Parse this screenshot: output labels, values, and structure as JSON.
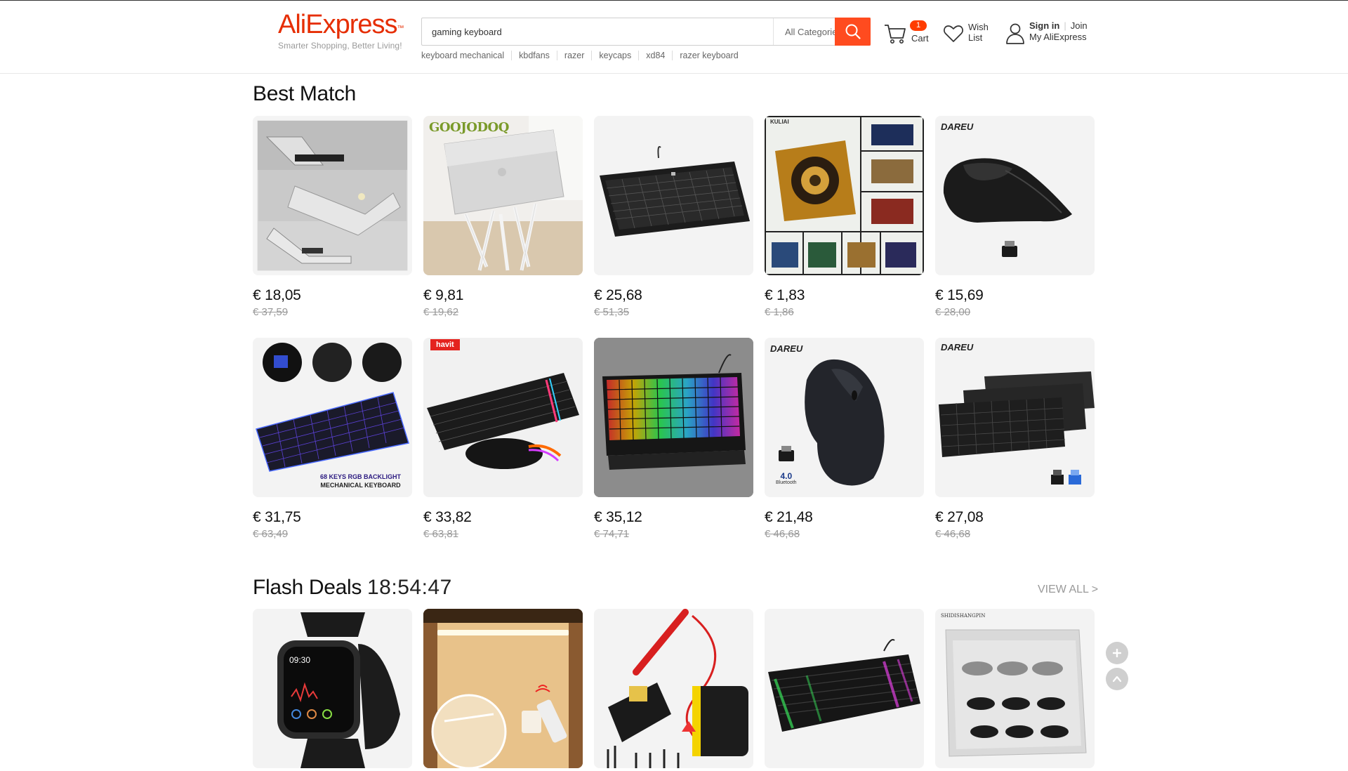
{
  "header": {
    "logo": {
      "brand": "AliExpress",
      "tagline": "Smarter Shopping, Better Living!"
    },
    "search": {
      "value": "gaming keyboard",
      "category": "All Categories",
      "button_icon": "search-icon"
    },
    "suggestions": [
      "keyboard mechanical",
      "kbdfans",
      "razer",
      "keycaps",
      "xd84",
      "razer keyboard"
    ],
    "cart": {
      "count": "1",
      "label": "Cart"
    },
    "wishlist": {
      "label_line1": "Wish",
      "label_line2": "List"
    },
    "account": {
      "sign_in": "Sign in",
      "join": "Join",
      "my_account": "My AliExpress"
    }
  },
  "best_match": {
    "title": "Best Match",
    "products": [
      {
        "price": "€ 18,05",
        "old_price": "€ 37,59",
        "image": "laptop-stand"
      },
      {
        "price": "€ 9,81",
        "old_price": "€ 19,62",
        "image": "laptop-stand-white",
        "brand_text": "GOOJODOQ"
      },
      {
        "price": "€ 25,68",
        "old_price": "€ 51,35",
        "image": "mechanical-keyboard"
      },
      {
        "price": "€ 1,83",
        "old_price": "€ 1,86",
        "image": "mouse-pad",
        "brand_text": "KULIAI"
      },
      {
        "price": "€ 15,69",
        "old_price": "€ 28,00",
        "image": "vertical-mouse",
        "brand_text": "DAREU"
      },
      {
        "price": "€ 31,75",
        "old_price": "€ 63,49",
        "image": "rgb-keyboard-68",
        "caption_line1": "68 KEYS RGB BACKLIGHT",
        "caption_line2": "MECHANICAL KEYBOARD"
      },
      {
        "price": "€ 33,82",
        "old_price": "€ 63,81",
        "image": "keyboard-mouse-combo",
        "brand_text": "havit"
      },
      {
        "price": "€ 35,12",
        "old_price": "€ 74,71",
        "image": "rgb-keyboard"
      },
      {
        "price": "€ 21,48",
        "old_price": "€ 46,68",
        "image": "ergonomic-mouse",
        "brand_text": "DAREU",
        "badge_text": "4.0",
        "badge_sub": "Bluetooth"
      },
      {
        "price": "€ 27,08",
        "old_price": "€ 46,68",
        "image": "keyboard-set",
        "brand_text": "DAREU"
      }
    ]
  },
  "flash_deals": {
    "title": "Flash Deals",
    "timer": "18:54:47",
    "view_all": "VIEW ALL >",
    "products": [
      {
        "image": "smart-watch",
        "watch_time": "09:30"
      },
      {
        "image": "led-light-bar"
      },
      {
        "image": "soldering-kit"
      },
      {
        "image": "rgb-keyboard-flash"
      },
      {
        "image": "eyelash-set",
        "brand_text": "SHIDISHANGPIN"
      }
    ]
  },
  "side_buttons": {
    "plus": "plus-icon",
    "top": "chevron-up-icon"
  },
  "colors": {
    "brand": "#e62e04",
    "accent": "#ff4b1f",
    "badge": "#ff3c00"
  }
}
